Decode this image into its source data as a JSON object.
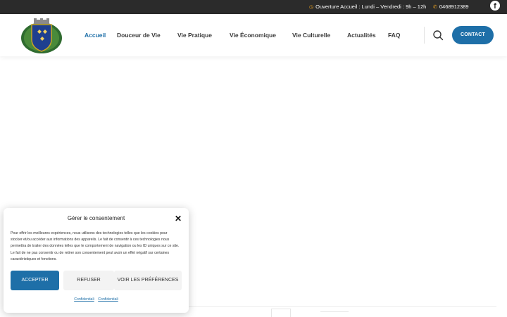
{
  "topbar": {
    "hours_icon": "clock-icon",
    "hours_text": "Ouverture Accueil : Lundi – Vendredi : 9h – 12h",
    "phone_icon": "phone-icon",
    "phone_text": "0468912389",
    "social_icon": "facebook-icon"
  },
  "nav": {
    "items": [
      {
        "label": "Accueil",
        "active": true
      },
      {
        "label": "Douceur de Vie"
      },
      {
        "label": "Vie Pratique"
      },
      {
        "label": "Vie Économique"
      },
      {
        "label": "Vie Culturelle"
      },
      {
        "label": "Actualités"
      },
      {
        "label": "FAQ"
      }
    ],
    "search_icon": "search-icon",
    "contact_label": "CONTACT"
  },
  "colors": {
    "accent": "#1e6fa8",
    "topbar_bg": "#2b2b2b",
    "icon_orange": "#e8a020"
  },
  "consent": {
    "title": "Gérer le consentement",
    "close_icon": "close-icon",
    "body": "Pour offrir les meilleures expériences, nous utilisons des technologies telles que les cookies pour stocker et/ou accéder aux informations des appareils. Le fait de consentir à ces technologies nous permettra de traiter des données telles que le comportement de navigation ou les ID uniques sur ce site. Le fait de ne pas consentir ou de retirer son consentement peut avoir un effet négatif sur certaines caractéristiques et fonctions.",
    "accept_label": "ACCEPTER",
    "refuse_label": "REFUSER",
    "prefs_label": "VOIR LES PRÉFÉRENCES",
    "link1": "Confidentiali",
    "link2": "Confidentiali"
  }
}
